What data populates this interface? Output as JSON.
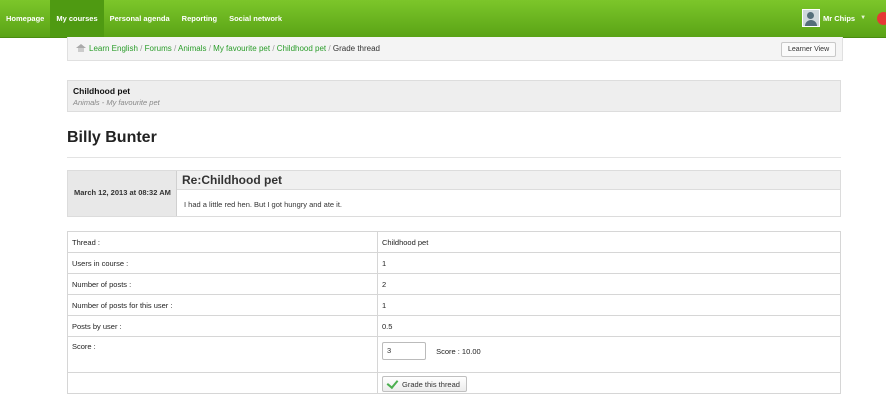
{
  "topnav": {
    "items": [
      {
        "label": "Homepage"
      },
      {
        "label": "My courses"
      },
      {
        "label": "Personal agenda"
      },
      {
        "label": "Reporting"
      },
      {
        "label": "Social network"
      }
    ],
    "active_index": 1,
    "user_name": "Mr Chips",
    "icons": [
      "avatar-icon",
      "chevron-down-icon",
      "power-icon"
    ]
  },
  "breadcrumb": {
    "items": [
      {
        "label": "Learn English"
      },
      {
        "label": "Forums"
      },
      {
        "label": "Animals"
      },
      {
        "label": "My favourite pet"
      },
      {
        "label": "Childhood pet"
      }
    ],
    "current": "Grade thread",
    "separator": "/",
    "learner_view_label": "Learner View"
  },
  "thread": {
    "title": "Childhood pet",
    "subtitle": "Animals - My favourite pet"
  },
  "user_heading": "Billy Bunter",
  "post": {
    "date": "March 12, 2013 at 08:32 AM",
    "title": "Re:Childhood pet",
    "text": "I had a little red hen. But I got hungry and ate it."
  },
  "info_table": {
    "thread_label": "Thread :",
    "thread_value": "Childhood pet",
    "users_label": "Users in course :",
    "users_value": "1",
    "posts_label": "Number of posts :",
    "posts_value": "2",
    "user_posts_label": "Number of posts for this user :",
    "user_posts_value": "1",
    "posts_by_user_label": "Posts by user :",
    "posts_by_user_value": "0.5",
    "score_label": "Score :",
    "score_input_value": "3",
    "score_text": "Score : 10.00",
    "grade_button_label": "Grade this thread"
  },
  "colors": {
    "nav_green": "#6bb51f",
    "link_green": "#2a9d2a"
  }
}
